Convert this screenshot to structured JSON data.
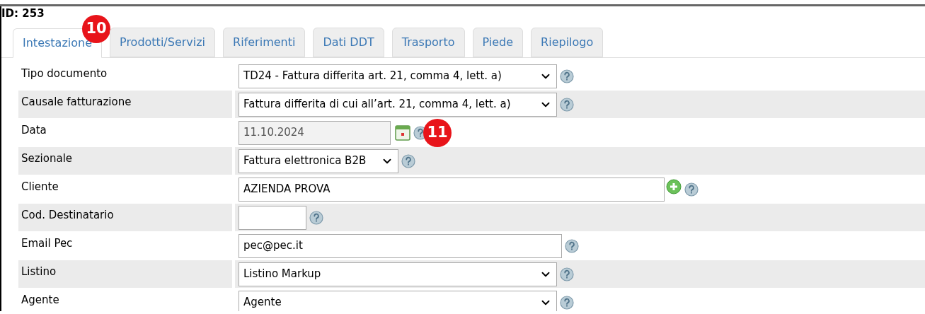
{
  "record_id": "ID: 253",
  "tabs": [
    {
      "label": "Intestazione",
      "selected": true,
      "callout": "10"
    },
    {
      "label": "Prodotti/Servizi",
      "selected": false
    },
    {
      "label": "Riferimenti",
      "selected": false
    },
    {
      "label": "Dati DDT",
      "selected": false
    },
    {
      "label": "Trasporto",
      "selected": false
    },
    {
      "label": "Piede",
      "selected": false
    },
    {
      "label": "Riepilogo",
      "selected": false
    }
  ],
  "fields": [
    {
      "label": "Tipo documento",
      "kind": "select",
      "value": "TD24 - Fattura differita art. 21, comma 4, lett. a)"
    },
    {
      "label": "Causale fatturazione",
      "kind": "select",
      "value": "Fattura differita di cui all’art. 21, comma 4, lett. a)"
    },
    {
      "label": "Data",
      "kind": "date",
      "value": "11.10.2024",
      "disabled": true,
      "callout": "11"
    },
    {
      "label": "Sezionale",
      "kind": "select",
      "value": "Fattura elettronica B2B"
    },
    {
      "label": "Cliente",
      "kind": "lookup",
      "value": "AZIENDA PROVA"
    },
    {
      "label": "Cod. Destinatario",
      "kind": "input"
    },
    {
      "label": "Email Pec",
      "kind": "input",
      "value": "pec@pec.it"
    },
    {
      "label": "Listino",
      "kind": "select",
      "value": "Listino Markup"
    },
    {
      "label": "Agente",
      "kind": "select",
      "value": "Agente"
    }
  ]
}
